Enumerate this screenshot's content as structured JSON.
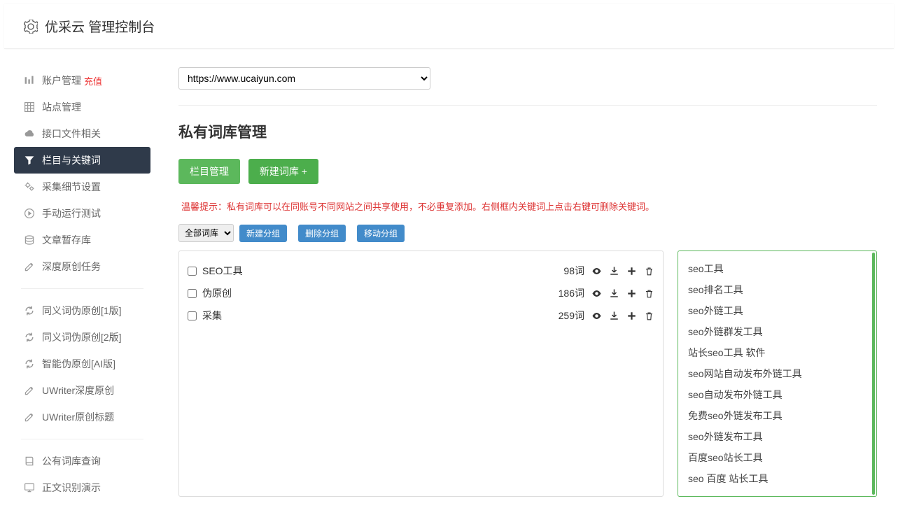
{
  "header": {
    "title": "优采云 管理控制台"
  },
  "sidebar": {
    "items": [
      {
        "icon": "bars",
        "label": "账户管理",
        "badge": "充值"
      },
      {
        "icon": "grid",
        "label": "站点管理"
      },
      {
        "icon": "cloud",
        "label": "接口文件相关"
      },
      {
        "icon": "filter",
        "label": "栏目与关键词",
        "active": true
      },
      {
        "icon": "cogs",
        "label": "采集细节设置"
      },
      {
        "icon": "play",
        "label": "手动运行测试"
      },
      {
        "icon": "stack",
        "label": "文章暂存库"
      },
      {
        "icon": "edit",
        "label": "深度原创任务"
      }
    ],
    "items2": [
      {
        "icon": "refresh",
        "label": "同义词伪原创[1版]"
      },
      {
        "icon": "refresh",
        "label": "同义词伪原创[2版]"
      },
      {
        "icon": "refresh",
        "label": "智能伪原创[AI版]"
      },
      {
        "icon": "edit",
        "label": "UWriter深度原创"
      },
      {
        "icon": "edit",
        "label": "UWriter原创标题"
      }
    ],
    "items3": [
      {
        "icon": "book",
        "label": "公有词库查询"
      },
      {
        "icon": "monitor",
        "label": "正文识别演示"
      }
    ]
  },
  "main": {
    "site_selected": "https://www.ucaiyun.com",
    "page_title": "私有词库管理",
    "btn_col_manage": "栏目管理",
    "btn_new_lib": "新建词库 +",
    "tip": "温馨提示：私有词库可以在同账号不同网站之间共享使用，不必重复添加。右侧框内关键词上点击右键可删除关键词。",
    "group_selected": "全部词库",
    "btn_new_group": "新建分组",
    "btn_del_group": "删除分组",
    "btn_move_group": "移动分组",
    "wordlibs": [
      {
        "name": "SEO工具",
        "count": "98词"
      },
      {
        "name": "伪原创",
        "count": "186词"
      },
      {
        "name": "采集",
        "count": "259词"
      }
    ],
    "keywords": [
      "seo工具",
      "seo排名工具",
      "seo外链工具",
      "seo外链群发工具",
      "站长seo工具 软件",
      "seo网站自动发布外链工具",
      "seo自动发布外链工具",
      "免费seo外链发布工具",
      "seo外链发布工具",
      "百度seo站长工具",
      "seo 百度 站长工具"
    ]
  }
}
